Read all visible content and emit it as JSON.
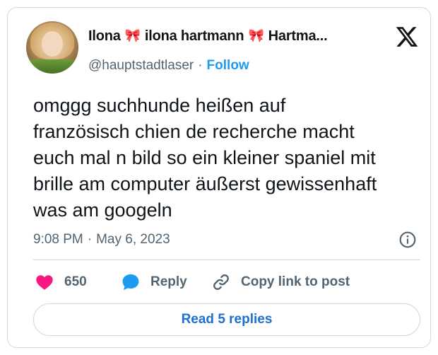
{
  "author": {
    "display_name_parts": [
      "Ilona",
      "ilona hartmann",
      "Hartma..."
    ],
    "handle": "@hauptstadtlaser",
    "separator": "·",
    "follow_label": "Follow"
  },
  "tweet": {
    "text": "omggg suchhunde heißen auf\nfranzösisch chien de recherche macht\neuch mal n bild so ein kleiner spaniel mit\nbrille am computer äußerst gewissenhaft\nwas am googeln",
    "time": "9:08 PM",
    "date": "May 6, 2023",
    "separator": "·"
  },
  "actions": {
    "like_count": "650",
    "reply_label": "Reply",
    "copy_label": "Copy link to post"
  },
  "footer": {
    "read_replies_label": "Read 5 replies"
  },
  "colors": {
    "like": "#f91880",
    "reply": "#1d9bf0",
    "link_blue": "#1d9bf0",
    "button_text": "#1d6fd1",
    "secondary": "#536471",
    "bow": "#e0245e"
  },
  "icons": {
    "logo": "x-logo-icon",
    "bow": "ribbon-bow-icon",
    "like": "heart-icon",
    "reply": "speech-bubble-icon",
    "copy": "link-icon",
    "info": "info-icon"
  }
}
